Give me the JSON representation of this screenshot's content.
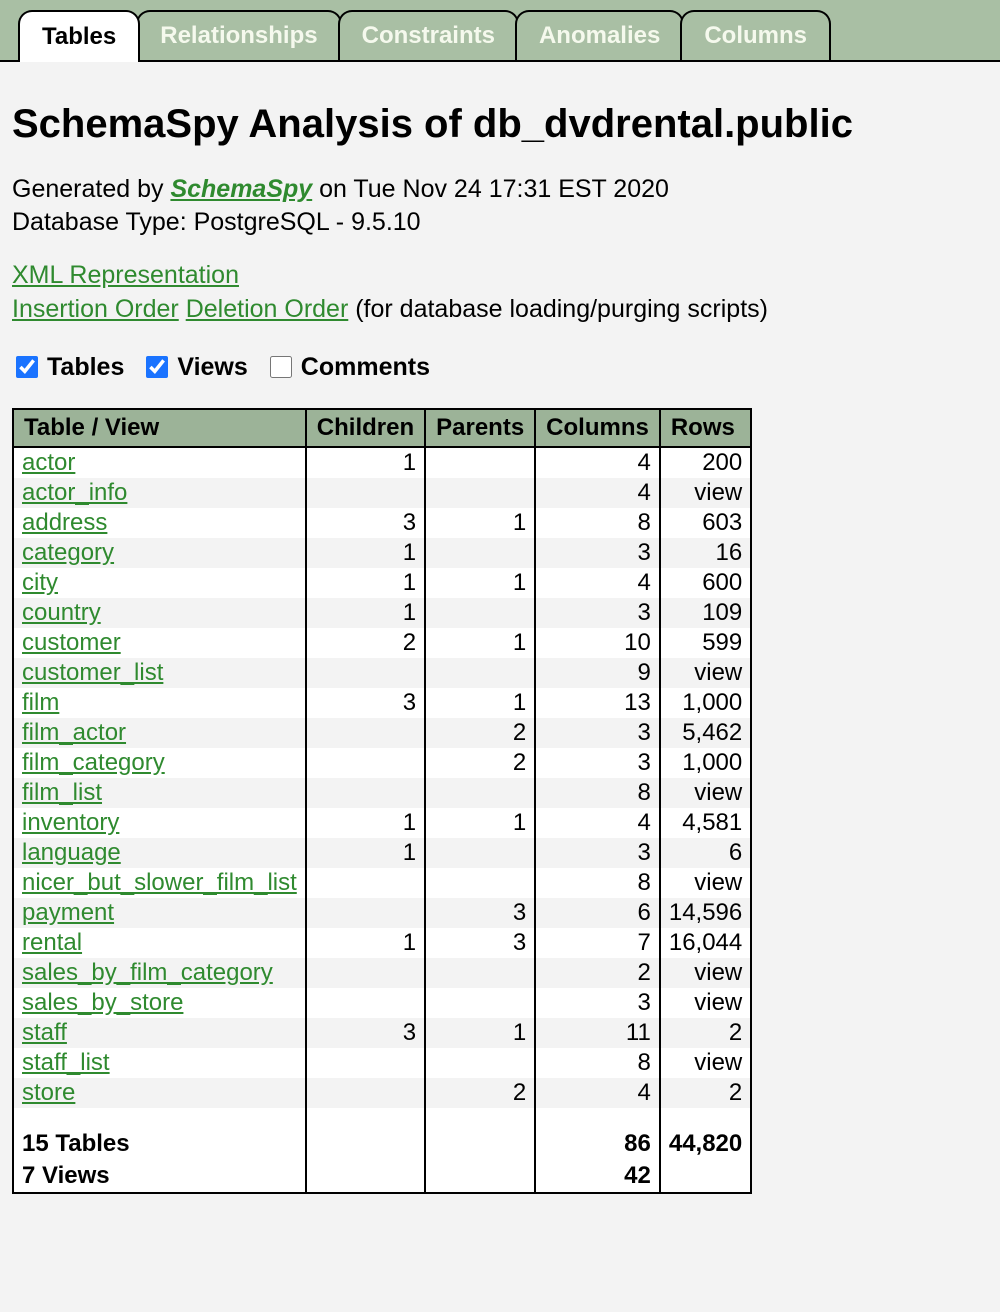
{
  "tabs": {
    "tables": "Tables",
    "relationships": "Relationships",
    "constraints": "Constraints",
    "anomalies": "Anomalies",
    "columns": "Columns"
  },
  "heading": "SchemaSpy Analysis of db_dvdrental.public",
  "generated_prefix": "Generated by ",
  "generated_link": "SchemaSpy",
  "generated_suffix": " on Tue Nov 24 17:31 EST 2020",
  "db_type": "Database Type: PostgreSQL - 9.5.10",
  "links": {
    "xml": "XML Representation",
    "insertion": "Insertion Order",
    "deletion": "Deletion Order",
    "scripts_note": " (for database loading/purging scripts)"
  },
  "filters": {
    "tables": "Tables",
    "views": "Views",
    "comments": "Comments"
  },
  "table": {
    "headers": {
      "name": "Table / View",
      "children": "Children",
      "parents": "Parents",
      "columns": "Columns",
      "rows": "Rows"
    },
    "rows": [
      {
        "name": "actor",
        "children": "1",
        "parents": "",
        "columns": "4",
        "rows": "200"
      },
      {
        "name": "actor_info",
        "children": "",
        "parents": "",
        "columns": "4",
        "rows": "view"
      },
      {
        "name": "address",
        "children": "3",
        "parents": "1",
        "columns": "8",
        "rows": "603"
      },
      {
        "name": "category",
        "children": "1",
        "parents": "",
        "columns": "3",
        "rows": "16"
      },
      {
        "name": "city",
        "children": "1",
        "parents": "1",
        "columns": "4",
        "rows": "600"
      },
      {
        "name": "country",
        "children": "1",
        "parents": "",
        "columns": "3",
        "rows": "109"
      },
      {
        "name": "customer",
        "children": "2",
        "parents": "1",
        "columns": "10",
        "rows": "599"
      },
      {
        "name": "customer_list",
        "children": "",
        "parents": "",
        "columns": "9",
        "rows": "view"
      },
      {
        "name": "film",
        "children": "3",
        "parents": "1",
        "columns": "13",
        "rows": "1,000"
      },
      {
        "name": "film_actor",
        "children": "",
        "parents": "2",
        "columns": "3",
        "rows": "5,462"
      },
      {
        "name": "film_category",
        "children": "",
        "parents": "2",
        "columns": "3",
        "rows": "1,000"
      },
      {
        "name": "film_list",
        "children": "",
        "parents": "",
        "columns": "8",
        "rows": "view"
      },
      {
        "name": "inventory",
        "children": "1",
        "parents": "1",
        "columns": "4",
        "rows": "4,581"
      },
      {
        "name": "language",
        "children": "1",
        "parents": "",
        "columns": "3",
        "rows": "6"
      },
      {
        "name": "nicer_but_slower_film_list",
        "children": "",
        "parents": "",
        "columns": "8",
        "rows": "view"
      },
      {
        "name": "payment",
        "children": "",
        "parents": "3",
        "columns": "6",
        "rows": "14,596"
      },
      {
        "name": "rental",
        "children": "1",
        "parents": "3",
        "columns": "7",
        "rows": "16,044"
      },
      {
        "name": "sales_by_film_category",
        "children": "",
        "parents": "",
        "columns": "2",
        "rows": "view"
      },
      {
        "name": "sales_by_store",
        "children": "",
        "parents": "",
        "columns": "3",
        "rows": "view"
      },
      {
        "name": "staff",
        "children": "3",
        "parents": "1",
        "columns": "11",
        "rows": "2"
      },
      {
        "name": "staff_list",
        "children": "",
        "parents": "",
        "columns": "8",
        "rows": "view"
      },
      {
        "name": "store",
        "children": "",
        "parents": "2",
        "columns": "4",
        "rows": "2"
      }
    ],
    "footer": {
      "tables_count": "15 Tables",
      "views_count": "7 Views",
      "columns_tables": "86",
      "columns_views": "42",
      "rows_total": "44,820"
    }
  }
}
